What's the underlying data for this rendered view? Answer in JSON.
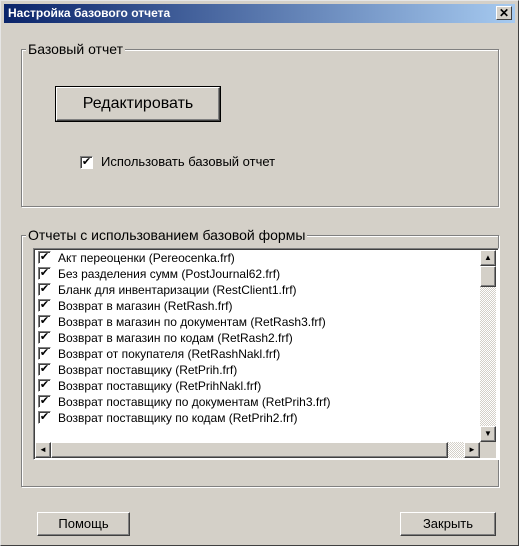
{
  "window": {
    "title": "Настройка базового отчета",
    "close_glyph": "✕"
  },
  "base_group": {
    "label": "Базовый отчет",
    "edit_button": "Редактировать",
    "use_base_checkbox": {
      "label": "Использовать базовый отчет",
      "checked": true
    }
  },
  "reports_group": {
    "label": "Отчеты с использованием базовой формы",
    "items": [
      {
        "label": "Акт переоценки (Pereocenka.frf)",
        "checked": true
      },
      {
        "label": "Без разделения сумм (PostJournal62.frf)",
        "checked": true
      },
      {
        "label": "Бланк для инвентаризации (RestClient1.frf)",
        "checked": true
      },
      {
        "label": "Возврат в магазин (RetRash.frf)",
        "checked": true
      },
      {
        "label": "Возврат в магазин по документам (RetRash3.frf)",
        "checked": true
      },
      {
        "label": "Возврат в магазин по кодам (RetRash2.frf)",
        "checked": true
      },
      {
        "label": "Возврат от покупателя (RetRashNakl.frf)",
        "checked": true
      },
      {
        "label": "Возврат поставщику (RetPrih.frf)",
        "checked": true
      },
      {
        "label": "Возврат поставщику (RetPrihNakl.frf)",
        "checked": true
      },
      {
        "label": "Возврат поставщику по документам (RetPrih3.frf)",
        "checked": true
      },
      {
        "label": "Возврат поставщику по кодам (RetPrih2.frf)",
        "checked": true
      }
    ],
    "scroll_up_glyph": "▲",
    "scroll_down_glyph": "▼",
    "scroll_left_glyph": "◄",
    "scroll_right_glyph": "►"
  },
  "footer": {
    "help_button": "Помощь",
    "close_button": "Закрыть"
  },
  "colors": {
    "face": "#d4d0c8",
    "title_start": "#0a246a",
    "title_end": "#a6caf0"
  }
}
